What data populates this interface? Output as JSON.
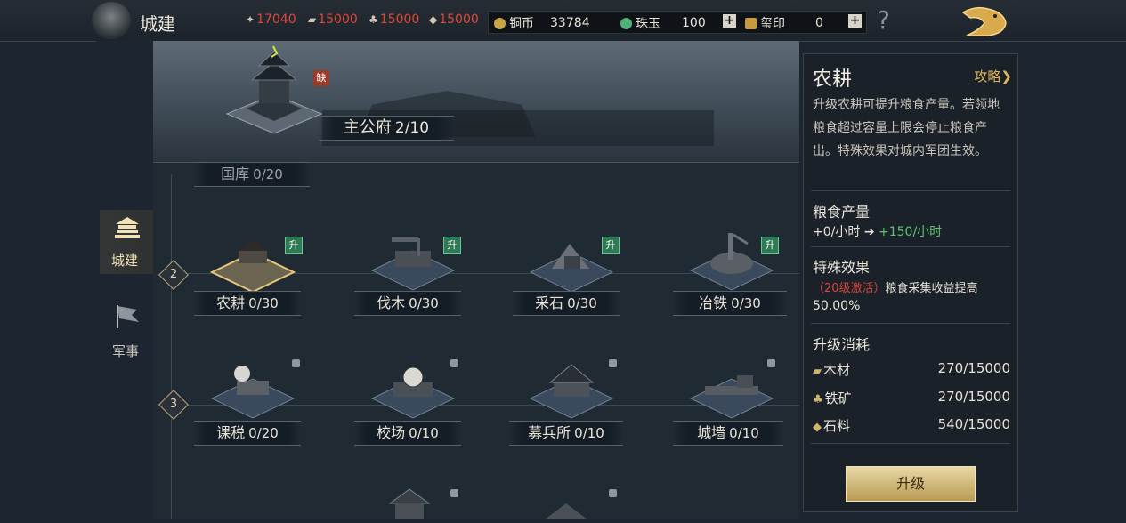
{
  "header": {
    "title": "城建",
    "resources": [
      "17040",
      "15000",
      "15000",
      "15000"
    ],
    "coins": {
      "label": "铜币",
      "value": "33784"
    },
    "jade": {
      "label": "珠玉",
      "value": "100"
    },
    "seal": {
      "label": "玺印",
      "value": "0"
    },
    "help": "?"
  },
  "sidebar": {
    "items": [
      {
        "label": "城建",
        "icon": "city-build-icon",
        "active": true
      },
      {
        "label": "军事",
        "icon": "military-flag-icon",
        "active": false
      }
    ]
  },
  "main": {
    "palace": {
      "name": "主公府",
      "level": "2/10",
      "badge": "缺"
    },
    "treasury": {
      "name": "国库",
      "level": "0/20"
    },
    "tiers": [
      "2",
      "3"
    ],
    "row2": [
      {
        "name": "农耕",
        "level": "0/30",
        "badge": "升"
      },
      {
        "name": "伐木",
        "level": "0/30",
        "badge": "升"
      },
      {
        "name": "采石",
        "level": "0/30",
        "badge": "升"
      },
      {
        "name": "冶铁",
        "level": "0/30",
        "badge": "升"
      }
    ],
    "row3": [
      {
        "name": "课税",
        "level": "0/20"
      },
      {
        "name": "校场",
        "level": "0/10"
      },
      {
        "name": "募兵所",
        "level": "0/10"
      },
      {
        "name": "城墙",
        "level": "0/10"
      }
    ]
  },
  "panel": {
    "title": "农耕",
    "guide": "攻略",
    "description": "升级农耕可提升粮食产量。若领地粮食超过容量上限会停止粮食产出。特殊效果对城内军团生效。",
    "output_heading": "粮食产量",
    "output_from": "+0/小时",
    "output_arrow": "➔",
    "output_to": "+150/小时",
    "effect_heading": "特殊效果",
    "effect_cond": "（20级激活）",
    "effect_text": "粮食采集收益提高",
    "effect_value": "50.00%",
    "cost_heading": "升级消耗",
    "costs": [
      {
        "name": "木材",
        "value": "270/15000"
      },
      {
        "name": "铁矿",
        "value": "270/15000"
      },
      {
        "name": "石料",
        "value": "540/15000"
      }
    ],
    "upgrade_button": "升级"
  },
  "colors": {
    "accent_gold": "#e0b55a",
    "resource_red": "#e0463a",
    "green": "#5fc36f",
    "badge_up": "#2f7a55",
    "badge_missing": "#9a3b2b"
  }
}
